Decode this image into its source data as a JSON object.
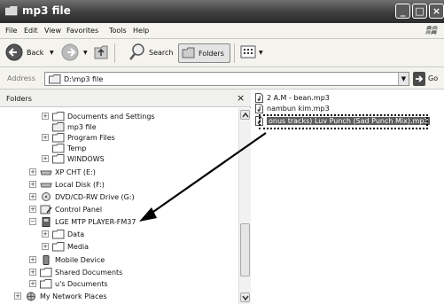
{
  "window": {
    "title": "mp3 file"
  },
  "menu": [
    "File",
    "Edit",
    "View",
    "Favorites",
    "Tools",
    "Help"
  ],
  "toolbar": {
    "back_label": "Back",
    "search_label": "Search",
    "folders_label": "Folders"
  },
  "address": {
    "label": "Address",
    "value": "D:\\mp3 file",
    "go_label": "Go"
  },
  "folders_pane": {
    "title": "Folders",
    "close_glyph": "×",
    "tree": [
      {
        "label": "Documents and Settings"
      },
      {
        "label": "mp3 file"
      },
      {
        "label": "Program Files"
      },
      {
        "label": "Temp"
      },
      {
        "label": "WINDOWS"
      },
      {
        "label": "XP CHT (E:)"
      },
      {
        "label": "Local Disk (F:)"
      },
      {
        "label": "DVD/CD-RW Drive (G:)"
      },
      {
        "label": "Control Panel"
      },
      {
        "label": "LGE MTP PLAYER-FM37"
      },
      {
        "label": "Data"
      },
      {
        "label": "Media"
      },
      {
        "label": "Mobile Device"
      },
      {
        "label": "Shared Documents"
      },
      {
        "label": "u's Documents"
      },
      {
        "label": "My Network Places"
      }
    ]
  },
  "files": [
    {
      "label": "2 A.M - bean.mp3"
    },
    {
      "label": "nambun kim.mp3"
    },
    {
      "label": "onus tracks) Luv Punch (Sad Punch Mix).mp3"
    }
  ],
  "colors": {
    "titlebar": "#3e3e3e",
    "selection": "#5c5c5c"
  }
}
